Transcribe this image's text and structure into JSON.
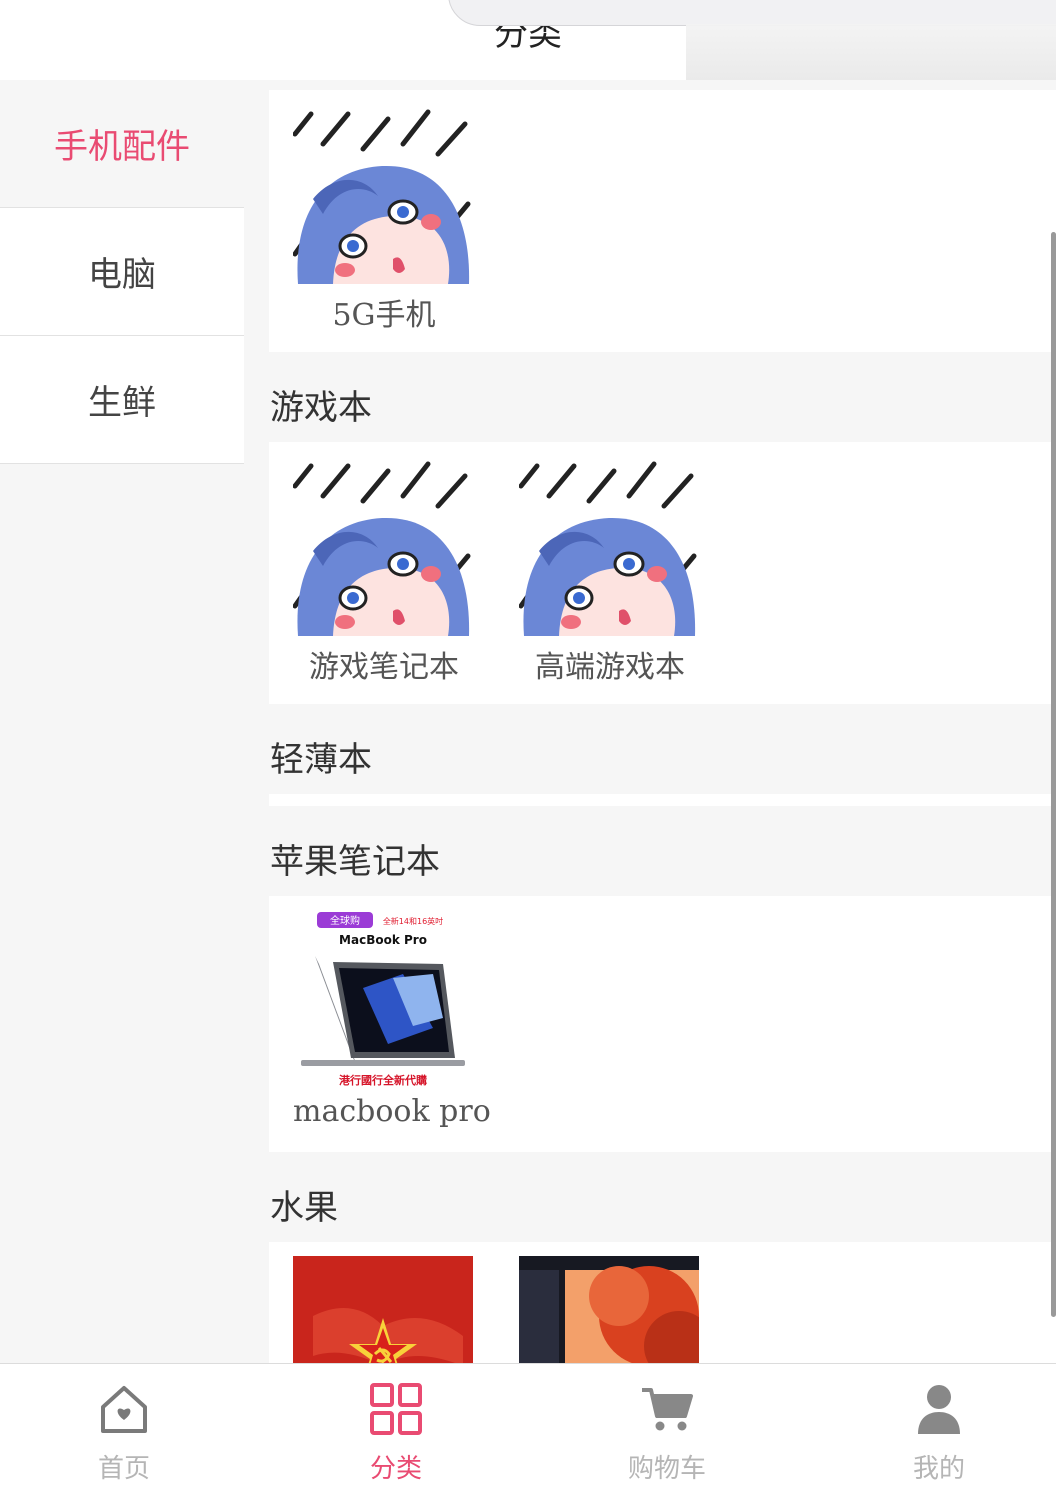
{
  "header": {
    "title": "分类"
  },
  "sidebar": {
    "items": [
      {
        "label": "手机配件",
        "active": true
      },
      {
        "label": "电脑",
        "active": false
      },
      {
        "label": "生鲜",
        "active": false
      }
    ]
  },
  "sections": [
    {
      "title": "",
      "products": [
        {
          "label": "5G手机",
          "image": "anime-girl-image"
        }
      ]
    },
    {
      "title": "游戏本",
      "products": [
        {
          "label": "游戏笔记本",
          "image": "anime-girl-image"
        },
        {
          "label": "高端游戏本",
          "image": "anime-girl-image"
        }
      ]
    },
    {
      "title": "轻薄本",
      "products": []
    },
    {
      "title": "苹果笔记本",
      "products": [
        {
          "label": "macbook pro",
          "image": "macbook-image"
        }
      ]
    },
    {
      "title": "水果",
      "products": [
        {
          "label": "",
          "image": "red-flag-image"
        },
        {
          "label": "",
          "image": "autumn-window-image"
        }
      ]
    }
  ],
  "macbook_ad": {
    "badge": "全球购",
    "tagline": "全新14和16英吋",
    "name": "MacBook Pro",
    "footer": "港行國行全新代購"
  },
  "tabbar": {
    "items": [
      {
        "label": "首页",
        "icon": "home-icon",
        "active": false
      },
      {
        "label": "分类",
        "icon": "category-grid-icon",
        "active": true
      },
      {
        "label": "购物车",
        "icon": "cart-icon",
        "active": false
      },
      {
        "label": "我的",
        "icon": "user-icon",
        "active": false
      }
    ]
  },
  "colors": {
    "accent": "#e94b72",
    "inactive_tab": "#b5b5b5",
    "background": "#f6f6f6"
  }
}
